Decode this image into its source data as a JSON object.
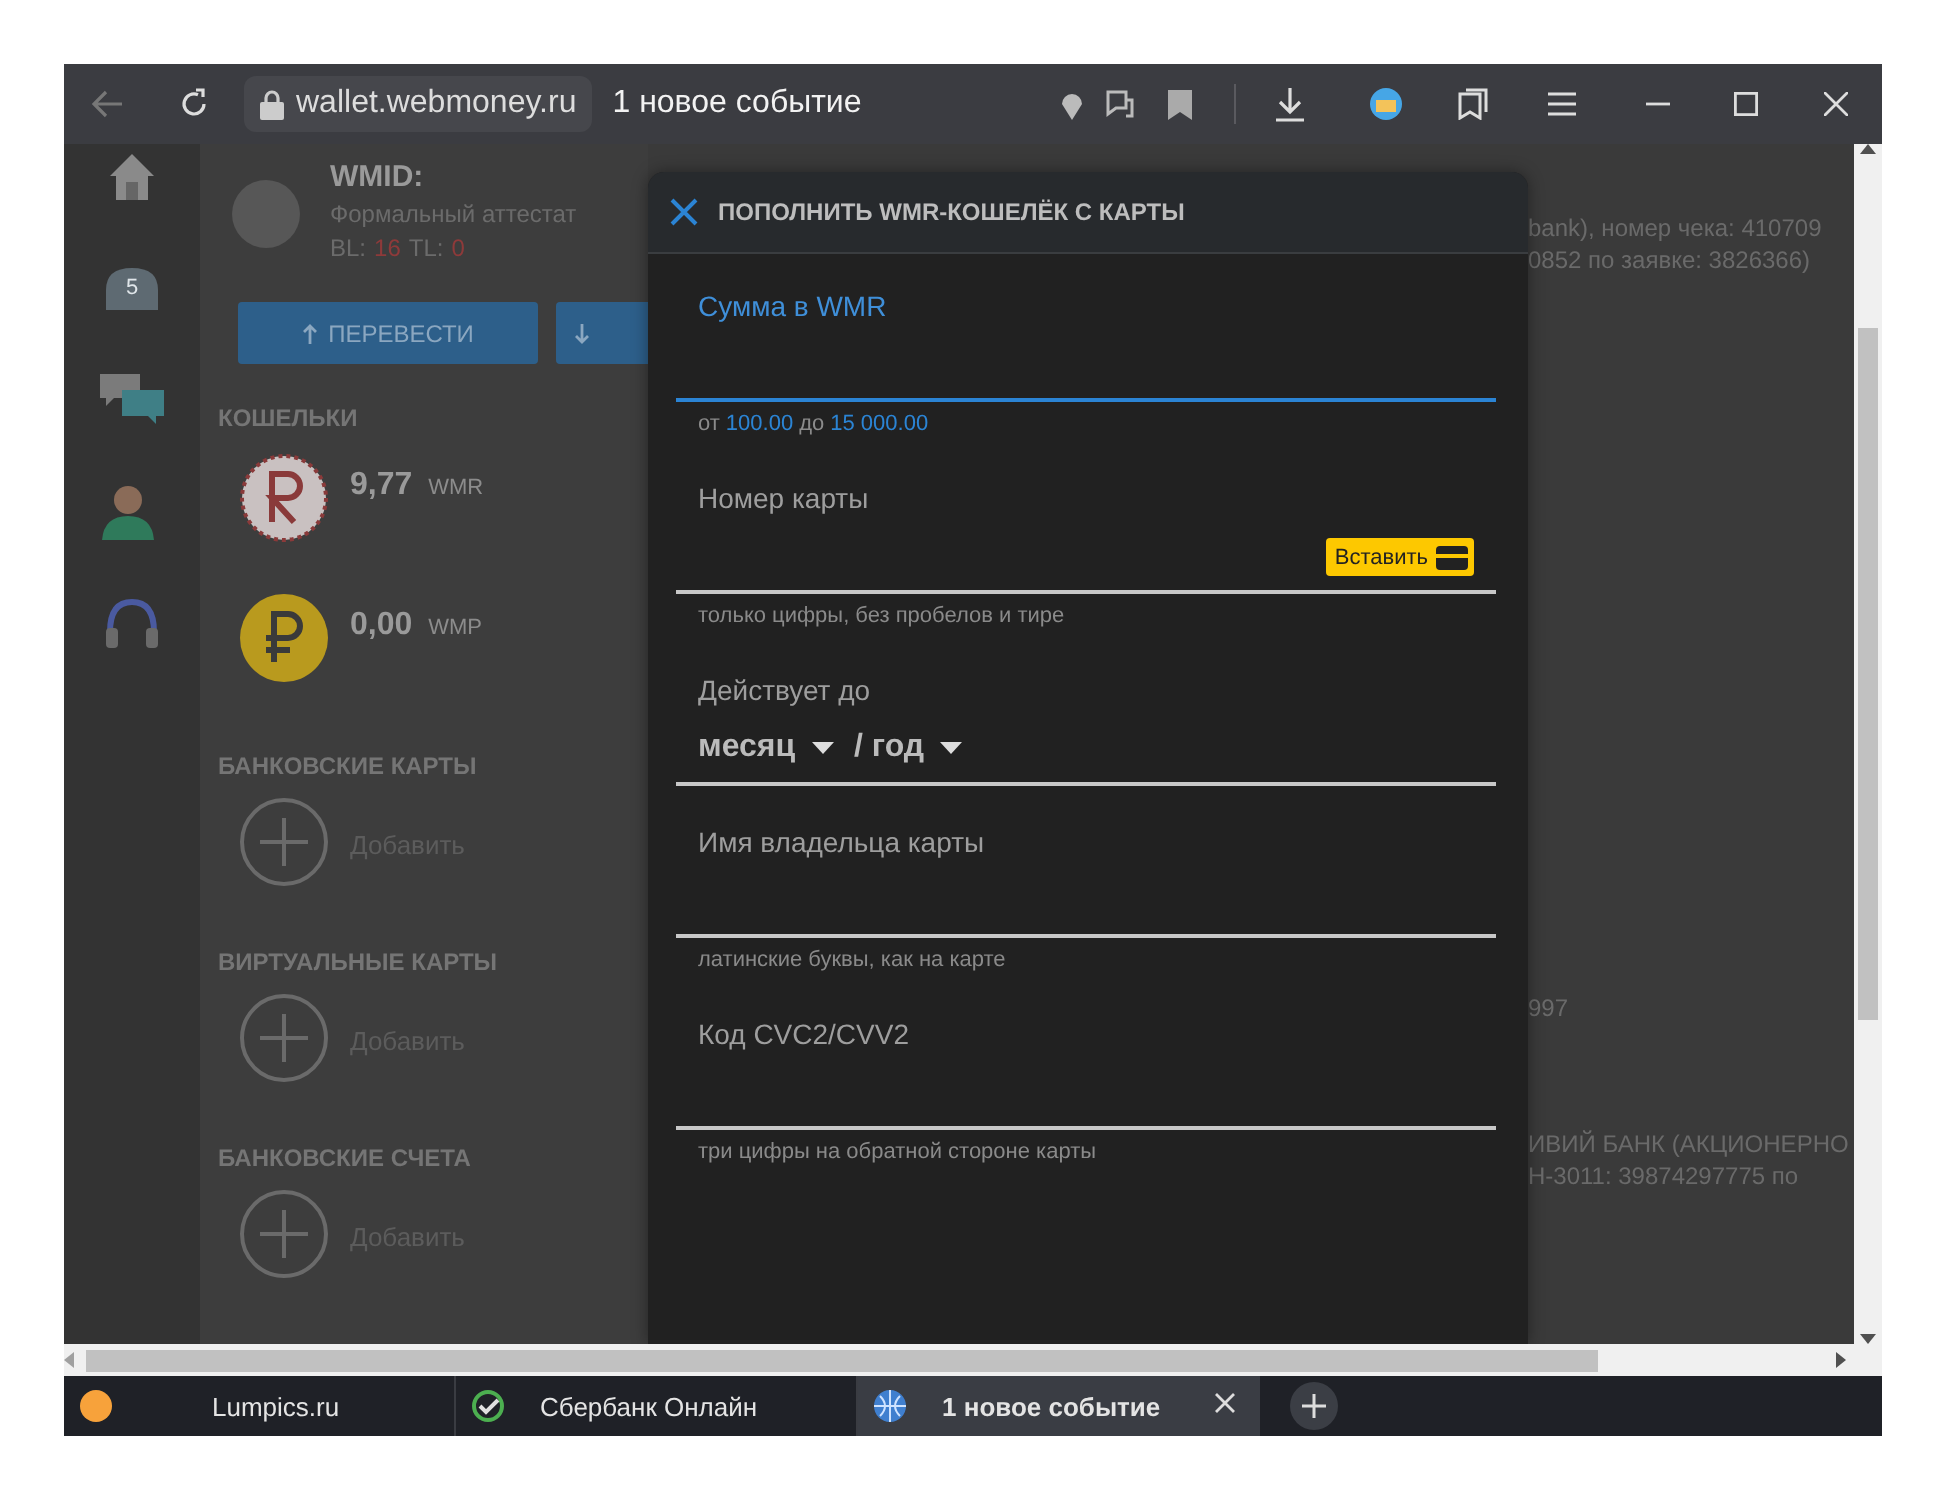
{
  "browser": {
    "address": "wallet.webmoney.ru",
    "page_title": "1 новое событие"
  },
  "page": {
    "nav_items": [
      {
        "kind": "home"
      },
      {
        "kind": "tray",
        "label": "5"
      },
      {
        "kind": "messages"
      },
      {
        "kind": "contacts"
      },
      {
        "kind": "support"
      }
    ],
    "profile": {
      "wmid_label": "WMID:",
      "attestat": "Формальный аттестат",
      "bl_label": "BL:",
      "bl_value": "16",
      "tl_label": "TL:",
      "tl_value": "0"
    },
    "actions": [
      {
        "kind": "transfer",
        "label": "ПЕРЕВЕСТИ"
      },
      {
        "kind": "receive"
      }
    ],
    "sections": [
      {
        "title": "КОШЕЛЬКИ",
        "items": [
          {
            "kind": "wmr",
            "amount": "9,77",
            "unit": "WMR"
          },
          {
            "kind": "wmp",
            "amount": "0,00",
            "unit": "WMP"
          }
        ]
      },
      {
        "title": "БАНКОВСКИЕ КАРТЫ",
        "items": [
          {
            "kind": "add",
            "label": "Добавить"
          }
        ]
      },
      {
        "title": "ВИРТУАЛЬНЫЕ КАРТЫ",
        "items": [
          {
            "kind": "add",
            "label": "Добавить"
          }
        ]
      },
      {
        "title": "БАНКОВСКИЕ СЧЕТА",
        "items": [
          {
            "kind": "add",
            "label": "Добавить"
          }
        ]
      }
    ],
    "right_notes": [
      {
        "lines": [
          "bank), номер чека: 410709",
          "0852 по заявке: 3826366)"
        ]
      },
      {
        "lines": [
          "997"
        ]
      },
      {
        "lines": [
          "ИВИЙ БАНК (АКЦИОНЕРНО",
          "Н-3011: 39874297775 по"
        ]
      }
    ]
  },
  "modal": {
    "title": "ПОПОЛНИТЬ WMR-КОШЕЛЁК С КАРТЫ",
    "fields": [
      {
        "kind": "text",
        "label": "Сумма в WMR",
        "focused": true,
        "range": {
          "from": "от",
          "min": "100.00",
          "to": "до",
          "max": "15 000.00"
        }
      },
      {
        "kind": "text",
        "label": "Номер карты",
        "focused": false,
        "paste_button": "Вставить",
        "hint": "только цифры, без пробелов и тире"
      },
      {
        "kind": "expiry",
        "label": "Действует до",
        "focused": false,
        "selects": [
          "месяц",
          "/ год"
        ]
      },
      {
        "kind": "text",
        "label": "Имя владельца карты",
        "focused": false,
        "hint": "латинские буквы, как на карте"
      },
      {
        "kind": "text",
        "label": "Код CVC2/CVV2",
        "focused": false,
        "hint": "три цифры на обратной стороне карты"
      }
    ]
  },
  "tabs": [
    {
      "title": "Lumpics.ru",
      "selected": false
    },
    {
      "title": "Сбербанк Онлайн",
      "selected": false
    },
    {
      "title": "1 новое событие",
      "selected": true
    }
  ]
}
